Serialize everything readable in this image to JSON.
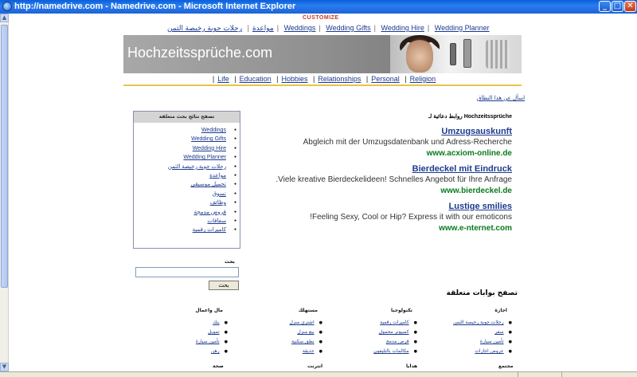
{
  "window": {
    "title": "http://namedrive.com - Namedrive.com - Microsoft Internet Explorer",
    "controls": {
      "minimize": "_",
      "maximize": "□",
      "close": "✕"
    }
  },
  "page": {
    "customize_label": "CUSTOMIZE",
    "top_nav": [
      {
        "label": "مواعدة"
      },
      {
        "label": "رحلات جوية رخيصة الثمن"
      },
      {
        "label": "Weddings"
      },
      {
        "label": "Wedding Gifts"
      },
      {
        "label": "Wedding Hire"
      },
      {
        "label": "Wedding Planner"
      }
    ],
    "banner": {
      "title": "Hochzeitssprüche.com"
    },
    "categories": [
      "Life",
      "Education",
      "Hobbies",
      "Relationships",
      "Personal",
      "Religion"
    ],
    "faq_link": "اسأل عن هذا النطاق",
    "sponsored_heading": "روابط دعائية لـ Hochzeitssprüche",
    "ads": [
      {
        "title": "Umzugsauskunft",
        "desc": "Abgleich mit der Umzugsdatenbank und Adress-Recherche",
        "url": "www.acxiom-online.de"
      },
      {
        "title": "Bierdeckel mit Eindruck",
        "desc": ".Viele kreative Bierdeckelideen! Schnelles Angebot für Ihre Anfrage",
        "url": "www.bierdeckel.de"
      },
      {
        "title": "Lustige smilies",
        "desc": "!Feeling Sexy, Cool or Hip? Express it with our emoticons",
        "url": "www.e-nternet.com"
      }
    ],
    "related": {
      "heading": "تصفح نتائج بحث متعلقة",
      "items": [
        "Weddings",
        "Wedding Gifts",
        "Wedding Hire",
        "Wedding Planner",
        "رحلات جوية رخيصة الثمن",
        "مواعدة",
        "تحميل موسيقى",
        "تسوق",
        "وظائف",
        "قروض مدمجة",
        "سفاقات",
        "كاميرات رقمية"
      ]
    },
    "search": {
      "label": "بحث",
      "button": "بحث",
      "value": ""
    },
    "portals": {
      "title": "تصفح بوابات متعلقة",
      "columns": [
        {
          "heading": "اجازة",
          "items": [
            "رحلات جوية رخيصة الثمن",
            "سفر",
            "تأمين سيارة",
            "عروض اجازات"
          ]
        },
        {
          "heading": "تكنولوجيا",
          "items": [
            "كاميرات رقمية",
            "كمبيوتر محمول",
            "قرص مدمج",
            "مكالمات بالتليفون"
          ]
        },
        {
          "heading": "مستهلك",
          "items": [
            "اشتري منزل",
            "بيع منزل",
            "نطق سكنية",
            "حديقة"
          ]
        },
        {
          "heading": "مال واعمال",
          "items": [
            "بنك",
            "تمويل",
            "تأمين سيارة",
            "رهن"
          ]
        }
      ],
      "bottom_headings": [
        "مجتمع",
        "هدايا",
        "انترنت",
        "صحة"
      ]
    }
  },
  "colors": {
    "link": "#1c3a8e",
    "url_green": "#0a7a1f",
    "accent_gold": "#e8c44a",
    "titlebar_blue": "#1d63d6"
  }
}
